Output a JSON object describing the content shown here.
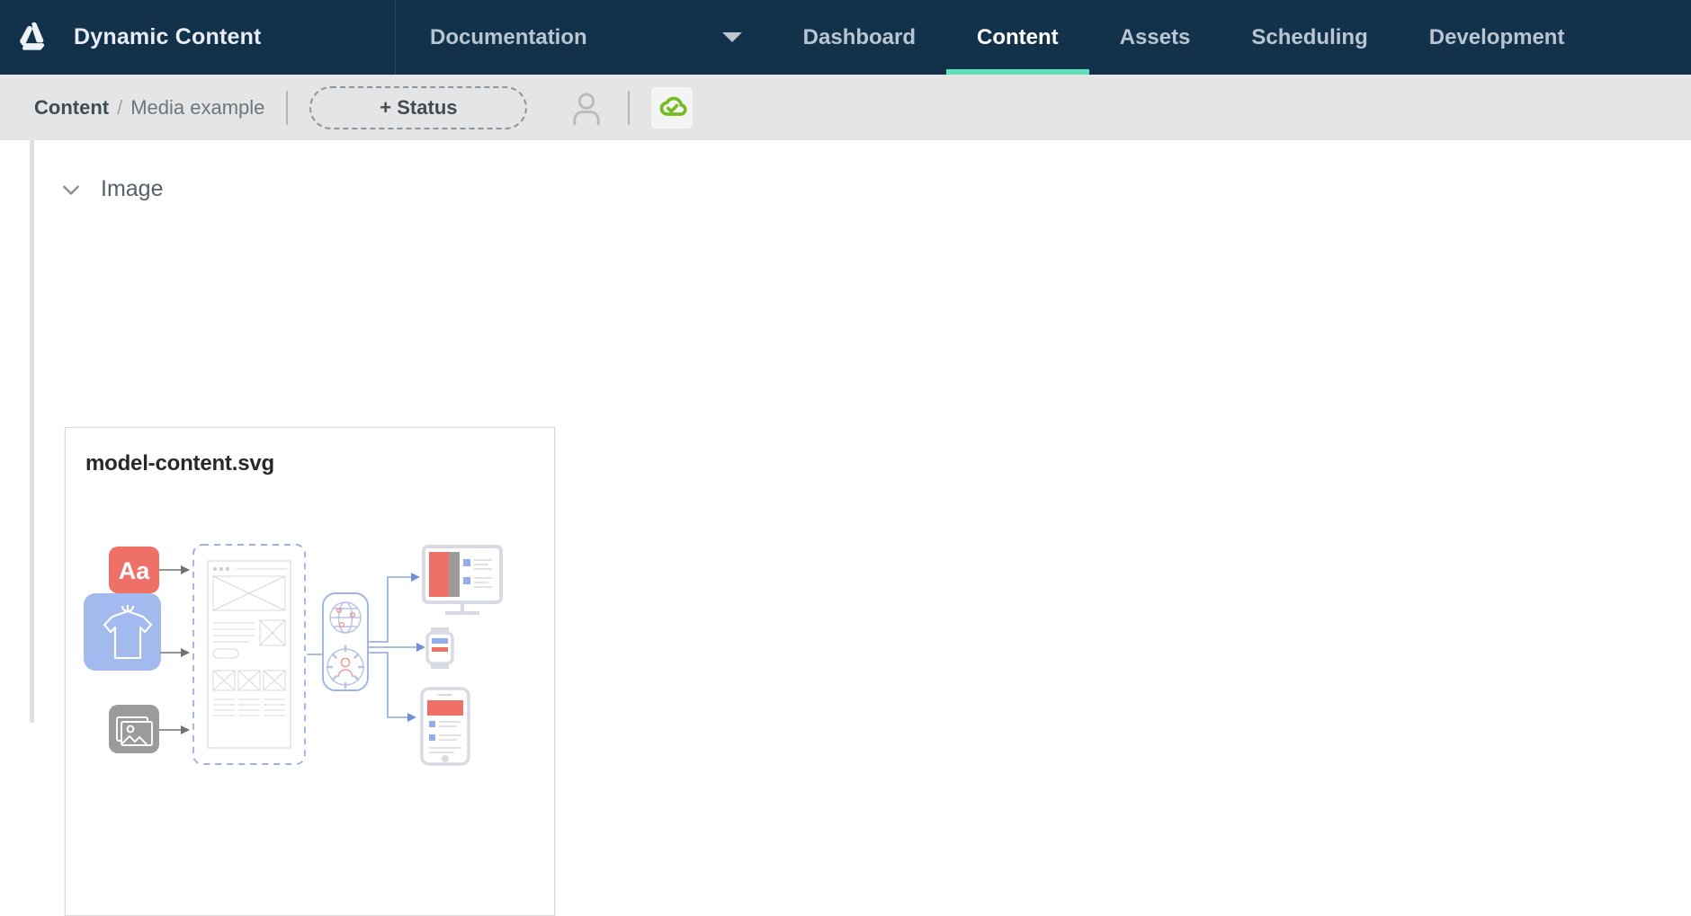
{
  "app": {
    "logo_icon": "amplience-logo-icon",
    "name": "Dynamic Content"
  },
  "topnav": {
    "dropdown": {
      "label": "Documentation",
      "caret_icon": "chevron-down-icon"
    },
    "tabs": [
      {
        "label": "Dashboard",
        "active": false
      },
      {
        "label": "Content",
        "active": true
      },
      {
        "label": "Assets",
        "active": false
      },
      {
        "label": "Scheduling",
        "active": false
      },
      {
        "label": "Development",
        "active": false
      }
    ],
    "active_tab": "Content",
    "bg_color": "#12314b",
    "active_indicator_color": "#5fe0b8"
  },
  "breadcrumb": {
    "root": "Content",
    "separator": "/",
    "leaf": "Media example"
  },
  "toolbar": {
    "status_button_label": "+ Status",
    "assignee_icon": "user-avatar-icon",
    "publish_icon": "cloud-check-icon",
    "publish_icon_color": "#76bc21"
  },
  "main": {
    "section": {
      "title": "Image",
      "toggle_icon": "chevron-down-icon",
      "expanded": true
    },
    "media": {
      "filename": "model-content.svg",
      "preview_icon": "content-model-diagram",
      "diagram": {
        "sources": [
          {
            "name": "text-icon",
            "label": "Aa",
            "color": "#ee7067"
          },
          {
            "name": "product-shirt-icon",
            "color": "#93aeeb"
          },
          {
            "name": "image-gallery-icon",
            "color": "#9b9b9b"
          }
        ],
        "center": {
          "name": "page-wireframe",
          "border": "dashed"
        },
        "services": [
          {
            "name": "globe-network-icon"
          },
          {
            "name": "gear-user-icon"
          }
        ],
        "outputs": [
          {
            "name": "desktop-monitor-icon"
          },
          {
            "name": "smartwatch-icon"
          },
          {
            "name": "smartphone-icon"
          }
        ],
        "accent_red": "#ee7067",
        "accent_blue": "#93aeeb",
        "line_color": "#8fa8de"
      }
    }
  }
}
